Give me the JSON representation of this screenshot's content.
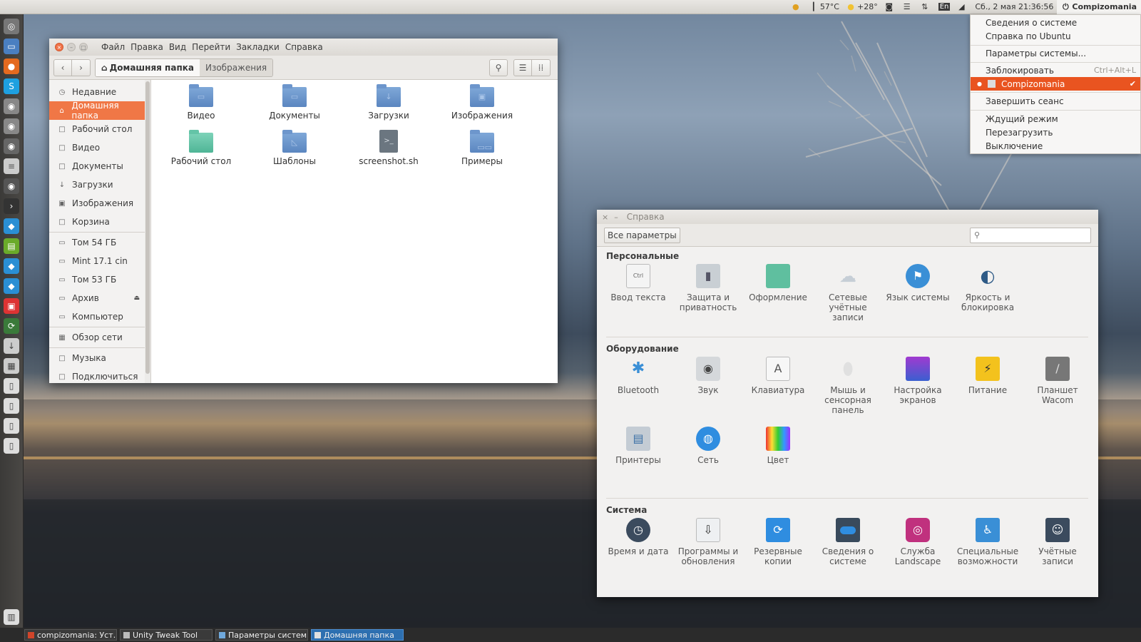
{
  "topbar": {
    "temp_cpu": "57°C",
    "weather": "+28°",
    "lang": "En",
    "datetime": "Сб., 2 мая 21:36:56",
    "user": "Compizomania"
  },
  "user_menu": [
    {
      "label": "Сведения о системе",
      "accel": ""
    },
    {
      "label": "Справка по Ubuntu",
      "accel": ""
    },
    {
      "label": "Параметры системы...",
      "accel": ""
    },
    {
      "label": "Заблокировать",
      "accel": "Ctrl+Alt+L"
    },
    {
      "label": "Compizomania",
      "accel": ""
    },
    {
      "label": "Завершить сеанс",
      "accel": ""
    },
    {
      "label": "Ждущий режим",
      "accel": ""
    },
    {
      "label": "Перезагрузить",
      "accel": ""
    },
    {
      "label": "Выключение",
      "accel": ""
    }
  ],
  "files": {
    "menu": [
      "Файл",
      "Правка",
      "Вид",
      "Перейти",
      "Закладки",
      "Справка"
    ],
    "breadcrumbs": [
      "Домашняя папка",
      "Изображения"
    ],
    "sidebar": [
      "Недавние",
      "Домашняя папка",
      "Рабочий стол",
      "Видео",
      "Документы",
      "Загрузки",
      "Изображения",
      "Корзина",
      "Том 54 ГБ",
      "Mint 17.1 cin",
      "Том 53 ГБ",
      "Архив",
      "Компьютер",
      "Обзор сети",
      "Музыка",
      "Подключиться"
    ],
    "items": [
      "Видео",
      "Документы",
      "Загрузки",
      "Изображения",
      "Рабочий стол",
      "Шаблоны",
      "screenshot.sh",
      "Примеры"
    ]
  },
  "settings": {
    "title": "Справка",
    "all_button": "Все параметры",
    "sections": {
      "personal": "Персональные",
      "hardware": "Оборудование",
      "system": "Система"
    },
    "personal": [
      "Ввод текста",
      "Защита и приватность",
      "Оформление",
      "Сетевые учётные записи",
      "Язык системы",
      "Яркость и блокировка"
    ],
    "hardware": [
      "Bluetooth",
      "Звук",
      "Клавиатура",
      "Мышь и сенсорная панель",
      "Настройка экранов",
      "Питание",
      "Планшет Wacom",
      "Принтеры",
      "Сеть",
      "Цвет"
    ],
    "system": [
      "Время и дата",
      "Программы и обновления",
      "Резервные копии",
      "Сведения о системе",
      "Служба Landscape",
      "Специальные возможности",
      "Учётные записи"
    ],
    "icon_text": {
      "ctrl": "Ctrl",
      "keyboard": "A"
    }
  },
  "taskbar": [
    "compizomania: Уст…",
    "Unity Tweak Tool",
    "Параметры системы",
    "Домашняя папка"
  ],
  "colors": {
    "accent": "#e95420",
    "selection": "#f07746",
    "folder": "#5b86c0"
  }
}
